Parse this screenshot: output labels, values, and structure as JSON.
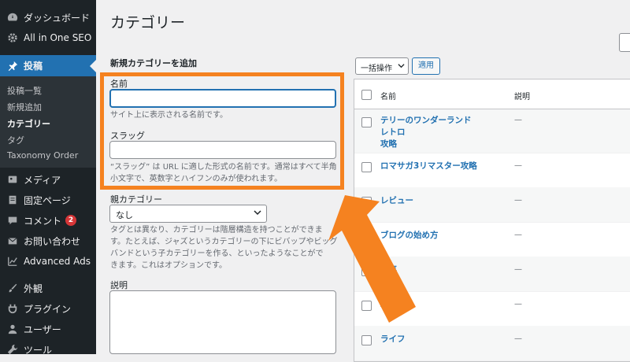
{
  "sidebar": {
    "items": [
      {
        "label": "ダッシュボード",
        "icon": "dashboard-icon"
      },
      {
        "label": "All in One SEO",
        "icon": "gear-icon"
      },
      {
        "label": "投稿",
        "icon": "pin-icon",
        "active": true
      },
      {
        "label": "メディア",
        "icon": "media-icon"
      },
      {
        "label": "固定ページ",
        "icon": "page-icon"
      },
      {
        "label": "コメント",
        "icon": "comment-icon",
        "badge": "2"
      },
      {
        "label": "お問い合わせ",
        "icon": "mail-icon"
      },
      {
        "label": "Advanced Ads",
        "icon": "chart-icon"
      },
      {
        "label": "外観",
        "icon": "brush-icon"
      },
      {
        "label": "プラグイン",
        "icon": "plugin-icon"
      },
      {
        "label": "ユーザー",
        "icon": "user-icon"
      },
      {
        "label": "ツール",
        "icon": "wrench-icon"
      }
    ],
    "submenu": [
      "投稿一覧",
      "新規追加",
      "カテゴリー",
      "タグ",
      "Taxonomy Order"
    ]
  },
  "page": {
    "title": "カテゴリー"
  },
  "form": {
    "heading": "新規カテゴリーを追加",
    "name_label": "名前",
    "name_value": "",
    "name_desc": "サイト上に表示される名前です。",
    "slug_label": "スラッグ",
    "slug_value": "",
    "slug_desc_1": "“スラッグ” は URL に適した形式の名前です。通常はすべて半角",
    "slug_desc_2": "小文字で、英数字とハイフンのみが使われます。",
    "parent_label": "親カテゴリー",
    "parent_value": "なし",
    "parent_desc_1": "タグとは異なり、カテゴリーは階層構造を持つことができま",
    "parent_desc_2": "す。たとえば、ジャズというカテゴリーの下にビバップやビッグ",
    "parent_desc_3": "バンドという子カテゴリーを作る、といったようなことがで",
    "parent_desc_4": "きます。これはオプションです。",
    "desc_label": "説明",
    "desc_value": ""
  },
  "toolbar": {
    "bulk_label": "一括操作",
    "apply_label": "適用"
  },
  "table": {
    "headers": {
      "name": "名前",
      "description": "説明"
    },
    "rows": [
      {
        "name_1": "テリーのワンダーランドレトロ",
        "name_2": "攻略",
        "desc": "—"
      },
      {
        "name_1": "ロマサガ3リマスター攻略",
        "name_2": "",
        "desc": "—"
      },
      {
        "name_1": "レビュー",
        "name_2": "",
        "desc": "—"
      },
      {
        "name_1": "ブログの始め方",
        "name_2": "",
        "desc": "—"
      },
      {
        "name_1": "仕事",
        "name_2": "",
        "desc": "—"
      },
      {
        "name_1": "転職",
        "name_2": "",
        "desc": "—"
      },
      {
        "name_1": "ライフ",
        "name_2": "",
        "desc": "—"
      }
    ]
  },
  "colors": {
    "accent": "#2271b1",
    "annotation": "#f58220",
    "sidebar": "#1d2327"
  }
}
